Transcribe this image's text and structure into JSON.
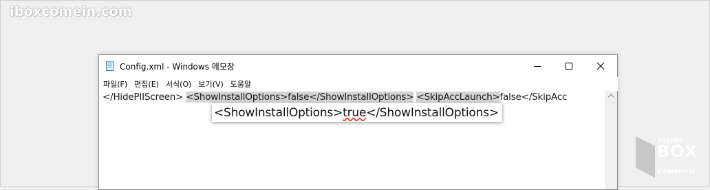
{
  "watermark": {
    "text": "iboxcomein.com"
  },
  "window": {
    "title": "Config.xml - Windows 메모장",
    "icon": "notepad-icon",
    "controls": {
      "minimize_icon": "minimize-icon",
      "maximize_icon": "maximize-icon",
      "close_icon": "close-icon"
    }
  },
  "menubar": {
    "items": [
      {
        "label": "파일(F)"
      },
      {
        "label": "편집(E)"
      },
      {
        "label": "서식(O)"
      },
      {
        "label": "보기(V)"
      },
      {
        "label": "도움말"
      }
    ]
  },
  "editor": {
    "segments": {
      "s1": "</HidePIIScreen>",
      "s2": "<ShowInstallOptions>false</ShowInstallOptions>",
      "s3": "<SkipAccLaunch>",
      "s4": "false</SkipAcc"
    },
    "highlight_color": "#d4d4d4"
  },
  "zoom_popup": {
    "open_tag": "<ShowInstallOptions>",
    "value": "true",
    "close_tag": "</ShowInstallOptions>",
    "spell_underline_color": "#e23030"
  },
  "logo": {
    "top": "Inside",
    "middle": "BOX",
    "bottom": "EZmanual"
  }
}
